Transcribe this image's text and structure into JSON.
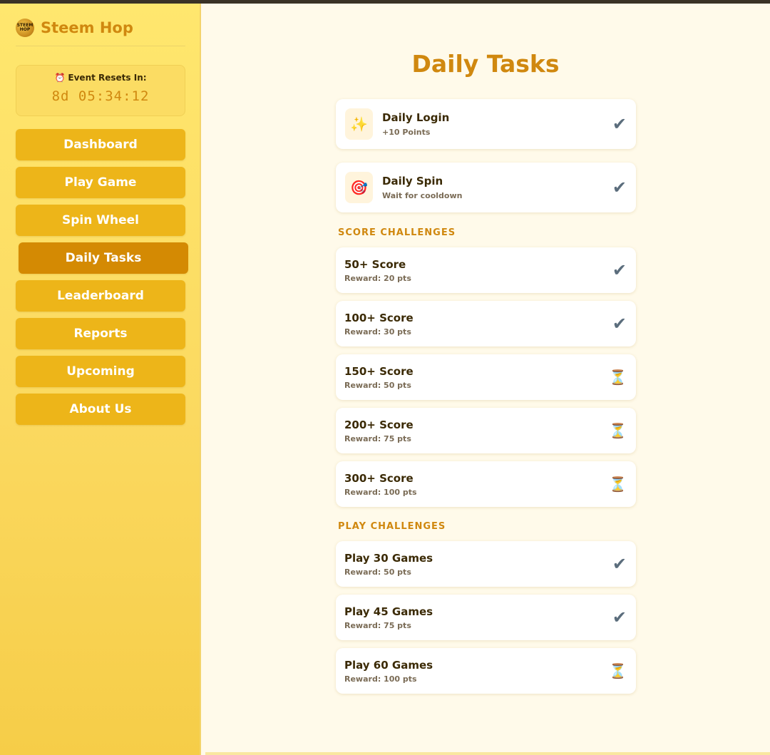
{
  "brand": {
    "title": "Steem Hop",
    "logo_text": "STEEM HOP"
  },
  "timer": {
    "label": "Event Resets In:",
    "value": "8d 05:34:12",
    "icon": "alarm-clock-icon"
  },
  "nav": [
    {
      "label": "Dashboard",
      "active": false
    },
    {
      "label": "Play Game",
      "active": false
    },
    {
      "label": "Spin Wheel",
      "active": false
    },
    {
      "label": "Daily Tasks",
      "active": true
    },
    {
      "label": "Leaderboard",
      "active": false
    },
    {
      "label": "Reports",
      "active": false
    },
    {
      "label": "Upcoming",
      "active": false
    },
    {
      "label": "About Us",
      "active": false
    }
  ],
  "page": {
    "title": "Daily Tasks"
  },
  "daily": [
    {
      "emoji": "✨",
      "icon": "sparkles-icon",
      "title": "Daily Login",
      "sub": "+10 Points",
      "status": "done"
    },
    {
      "emoji": "🎯",
      "icon": "target-icon",
      "title": "Daily Spin",
      "sub": "Wait for cooldown",
      "status": "done"
    }
  ],
  "score_section": {
    "title": "SCORE CHALLENGES"
  },
  "score": [
    {
      "title": "50+ Score",
      "sub": "Reward: 20 pts",
      "status": "done"
    },
    {
      "title": "100+ Score",
      "sub": "Reward: 30 pts",
      "status": "done"
    },
    {
      "title": "150+ Score",
      "sub": "Reward: 50 pts",
      "status": "pending"
    },
    {
      "title": "200+ Score",
      "sub": "Reward: 75 pts",
      "status": "pending"
    },
    {
      "title": "300+ Score",
      "sub": "Reward: 100 pts",
      "status": "pending"
    }
  ],
  "play_section": {
    "title": "PLAY CHALLENGES"
  },
  "play": [
    {
      "title": "Play 30 Games",
      "sub": "Reward: 50 pts",
      "status": "done"
    },
    {
      "title": "Play 45 Games",
      "sub": "Reward: 75 pts",
      "status": "done"
    },
    {
      "title": "Play 60 Games",
      "sub": "Reward: 100 pts",
      "status": "pending"
    }
  ],
  "status_glyphs": {
    "done": "✔",
    "pending": "⏳"
  },
  "colors": {
    "accent": "#d0880f",
    "nav": "#edb519",
    "nav_active": "#d48a03"
  }
}
